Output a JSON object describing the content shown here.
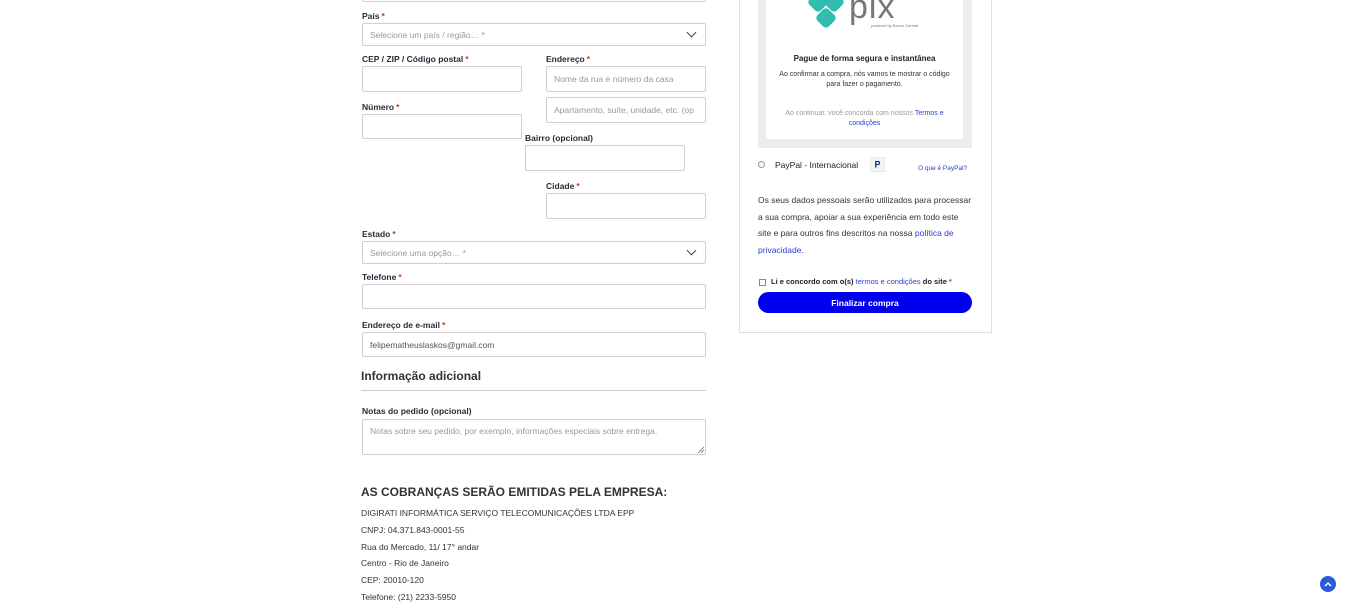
{
  "form": {
    "pais": {
      "label": "País",
      "placeholder": "Selecione um país / região… *"
    },
    "cep": {
      "label": "CEP / ZIP / Código postal"
    },
    "endereco": {
      "label": "Endereço",
      "placeholder": "Nome da rua e número da casa",
      "placeholder2": "Apartamento, suíte, unidade, etc. (op"
    },
    "numero": {
      "label": "Número"
    },
    "bairro": {
      "label": "Bairro (opcional)"
    },
    "cidade": {
      "label": "Cidade"
    },
    "estado": {
      "label": "Estado",
      "placeholder": "Selecione uma opção… *"
    },
    "telefone": {
      "label": "Telefone"
    },
    "email": {
      "label": "Endereço de e-mail",
      "value": "felipematheuslaskos@gmail.com"
    },
    "required_mark": "*"
  },
  "additional": {
    "title": "Informação adicional",
    "notes_label": "Notas do pedido (opcional)",
    "notes_placeholder": "Notas sobre seu pedido, por exemplo, informações especiais sobre entrega."
  },
  "company": {
    "title": "AS COBRANÇAS SERÃO EMITIDAS PELA EMPRESA:",
    "lines": [
      "DIGIRATI INFORMÁTICA SERVIÇO TELECOMUNICAÇÕES LTDA EPP",
      "CNPJ: 04.371.843-0001-55",
      "Rua do Mercado, 11/ 17° andar",
      "Centro - Rio de Janeiro",
      "CEP: 20010-120",
      "Telefone: (21) 2233-5950"
    ]
  },
  "payment": {
    "pix": {
      "logo_text": "pix",
      "logo_sub": "powered by Banco Central",
      "title": "Pague de forma segura e instantânea",
      "desc": "Ao confirmar a compra, nós vamos te mostrar o código para fazer o pagamento.",
      "terms_prefix": "Ao continuar, você concorda com nossos",
      "terms_link": "Termos e condições"
    },
    "paypal": {
      "label": "PayPal - Internacional",
      "what_is": "O que é PayPal?"
    },
    "privacy_text": "Os seus dados pessoais serão utilizados para processar a sua compra, apoiar a sua experiência em todo este site e para outros fins descritos na nossa",
    "privacy_link": "política de privacidade",
    "privacy_end": ".",
    "agree_prefix": "Li e concordo com o(s)",
    "agree_link": "termos e condições",
    "agree_suffix": "do site",
    "submit": "Finalizar compra"
  },
  "colors": {
    "accent": "#0000ee",
    "pix": "#32bcad",
    "link": "#2a3fd6"
  }
}
